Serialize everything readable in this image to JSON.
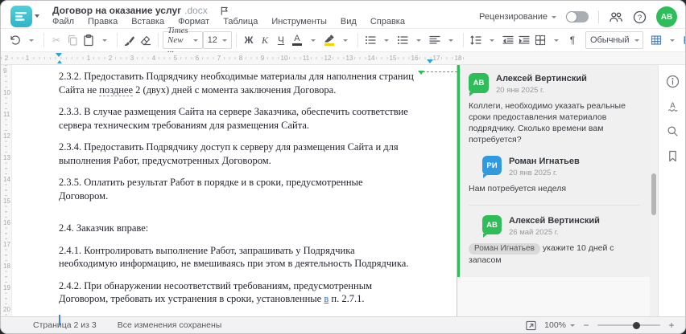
{
  "header": {
    "title": "Договор на оказание услуг",
    "title_ext": ".docx",
    "menu": [
      "Файл",
      "Правка",
      "Вставка",
      "Формат",
      "Таблица",
      "Инструменты",
      "Вид",
      "Справка"
    ],
    "review_label": "Рецензирование",
    "avatar_initials": "АВ"
  },
  "toolbar": {
    "font_name": "Times New ...",
    "font_size": "12",
    "bold_label": "Ж",
    "italic_label": "К",
    "underline_label": "Ч",
    "font_color_label": "А",
    "pilcrow_label": "¶",
    "style_name": "Обычный",
    "more_label": "•••"
  },
  "ruler": {
    "h_numbers": [
      "2",
      "1",
      "1",
      "2",
      "3",
      "4",
      "5",
      "6",
      "7",
      "8",
      "9",
      "10",
      "11",
      "12",
      "13",
      "14",
      "15",
      "16",
      "17",
      "18"
    ],
    "v_numbers": [
      "9",
      "10",
      "11",
      "12",
      "13",
      "14",
      "15",
      "16",
      "17",
      "18",
      "19",
      "20"
    ]
  },
  "document": {
    "p232_pre": "2.3.2. Предоставить Подрядчику необходимые материалы для наполнения страниц Сайта не ",
    "p232_anchor": "позднее",
    "p232_post": " 2 (двух) дней с момента заключения Договора.",
    "p233": "2.3.3. В случае размещения Сайта на сервере Заказчика, обеспечить соответствие сервера техническим требованиям для размещения Сайта.",
    "p234": "2.3.4. Предоставить Подрядчику доступ к серверу для размещения Сайта и для выполнения Работ, предусмотренных Договором.",
    "p235": "2.3.5. Оплатить результат Работ в порядке и в сроки, предусмотренные Договором.",
    "p24": "2.4. Заказчик вправе:",
    "p241": "2.4.1. Контролировать выполнение Работ, запрашивать у Подрядчика необходимую информацию, не вмешиваясь при этом в деятельность Подрядчика.",
    "p242_pre": "2.4.2. При обнаружении несоответствий требованиям, предусмотренным Договором, требовать их устранения в сроки, установленные ",
    "p242_ins": "в",
    "p242_post": " п. 2.7.1."
  },
  "comments": {
    "main": {
      "initials": "АВ",
      "name": "Алексей Вертинский",
      "date": "20 янв 2025 г.",
      "text": "Коллеги, необходимо указать реальные сроки предоставления материалов подрядчику. Сколько времени вам потребуется?"
    },
    "reply1": {
      "initials": "РИ",
      "name": "Роман Игнатьев",
      "date": "20 янв 2025 г.",
      "text": "Нам потребуется неделя"
    },
    "reply2": {
      "initials": "АВ",
      "name": "Алексей Вертинский",
      "date": "26 май 2025 г.",
      "mention": "Роман Игнатьев",
      "text": "укажите 10 дней с запасом"
    }
  },
  "statusbar": {
    "page_info": "Страница 2 из 3",
    "save_status": "Все изменения сохранены",
    "zoom_value": "100%"
  },
  "colors": {
    "accent_teal": "#3ec1cd",
    "comment_green": "#2ebd59",
    "reply_blue": "#2f9ae0",
    "ruler_marker_blue": "#2da3d9"
  }
}
